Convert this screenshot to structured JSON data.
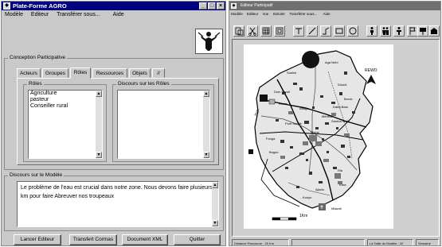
{
  "left_window": {
    "title": "Plate-Forme AGRO",
    "menu": [
      "Modèle",
      "Editeur",
      "Transférer sous...",
      "Aide"
    ],
    "section_title": "Conception Participative",
    "tabs": [
      "Acteurs",
      "Groupes",
      "Rôles",
      "Ressources",
      "Objets",
      "//"
    ],
    "active_tab": "Rôles",
    "roles_label": "Rôles",
    "roles": [
      "Agriculture",
      "pasteur",
      "Conseiller rural"
    ],
    "discours_roles_label": "Discours sur les Rôles",
    "discours_modele_label": "Discours sur le Modèle",
    "discours_modele_text": "Le problème de l'eau est crucial dans notre zone. Nous devons faire plusieurs km pour faire Abreuver  nos troupeaux",
    "buttons": [
      "Lancer Editeur",
      "Transfert Cormas",
      "Document XML",
      "Quitter"
    ]
  },
  "right_window": {
    "title": "Editeur Participatif",
    "menu": [
      "Modèle",
      "Editeur",
      "Vue",
      "Simuler",
      "Transférer sous...",
      "Aide"
    ],
    "map_labels": {
      "north": "REWO",
      "scale": "1Km",
      "town_hall": "Mairie",
      "villages": [
        "Sonimi",
        "Aga Nebi",
        "Dioudi",
        "Borok",
        "Daba Bala",
        "Médina",
        "Samba Sodé",
        "Pont Sondé",
        "Dom Sandi",
        "Fonga",
        "Bogou",
        "Aftaga",
        "Dia",
        "Kara",
        "Ajaolo",
        "Kouyo"
      ],
      "roads": [
        "Piste",
        "Route",
        "Mawati"
      ]
    },
    "status": [
      "Distance Parcourue : 20 Km",
      "",
      "La Taille du Modèle : 10",
      "Semaine"
    ]
  },
  "colors": {
    "title_active": "#000080",
    "title_inactive": "#6f6f6f",
    "face": "#c9c9c9"
  }
}
